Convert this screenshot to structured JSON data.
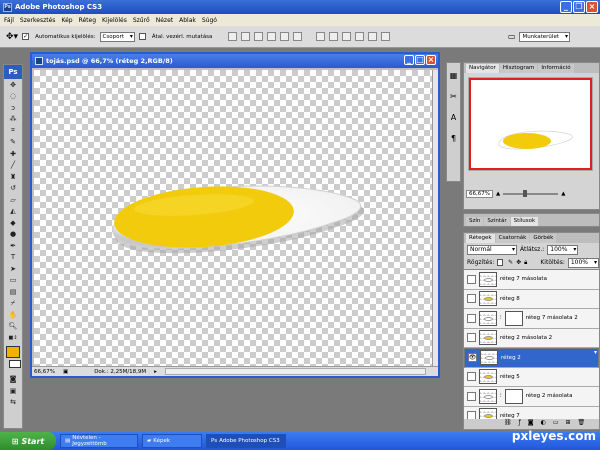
{
  "app_title": "Adobe Photoshop CS3",
  "menu": [
    "Fájl",
    "Szerkesztés",
    "Kép",
    "Réteg",
    "Kijelölés",
    "Szűrő",
    "Nézet",
    "Ablak",
    "Súgó"
  ],
  "options": {
    "auto_select_label": "Automatikus kijelölés:",
    "auto_select_value": "Csoport",
    "show_transform_label": "Átal. vezérl. mutatása",
    "workspace_label": "Munkaterület"
  },
  "document": {
    "title": "tojás.psd @ 66,7% (réteg 2,RGB/8)",
    "zoom": "66,67%",
    "doc_info": "Dok.: 2,25M/18,9M"
  },
  "navigator": {
    "tabs": [
      "Navigátor",
      "Hisztogram",
      "Információ"
    ],
    "zoom": "66,67%"
  },
  "color_panel": {
    "tabs": [
      "Szín",
      "Színtár",
      "Stílusok"
    ]
  },
  "layers_panel": {
    "tabs": [
      "Rétegek",
      "Csatornák",
      "Görbék"
    ],
    "blend_mode": "Normál",
    "opacity_label": "Átlátsz.:",
    "opacity_value": "100%",
    "lock_label": "Rögzítés:",
    "fill_label": "Kitöltés:",
    "fill_value": "100%",
    "layers": [
      {
        "name": "réteg 7 másolata",
        "visible": false,
        "mask": false,
        "selected": false
      },
      {
        "name": "réteg 8",
        "visible": false,
        "mask": false,
        "selected": false
      },
      {
        "name": "réteg 7 másolata 2",
        "visible": false,
        "mask": true,
        "selected": false
      },
      {
        "name": "réteg 2 másolata 2",
        "visible": false,
        "mask": false,
        "selected": false
      },
      {
        "name": "réteg 2",
        "visible": true,
        "mask": false,
        "selected": true
      },
      {
        "name": "réteg 5",
        "visible": false,
        "mask": false,
        "selected": false
      },
      {
        "name": "réteg 2 másolata",
        "visible": false,
        "mask": true,
        "selected": false
      },
      {
        "name": "réteg 7",
        "visible": false,
        "mask": false,
        "selected": false
      }
    ]
  },
  "taskbar": {
    "start": "Start",
    "tasks": [
      "Névtelen - Jegyzettömb",
      "Képek",
      "Adobe Photoshop CS3"
    ],
    "brand": "pxleyes.com"
  },
  "colors": {
    "yolk": "#f2cc0c",
    "selection": "#3366cc"
  }
}
